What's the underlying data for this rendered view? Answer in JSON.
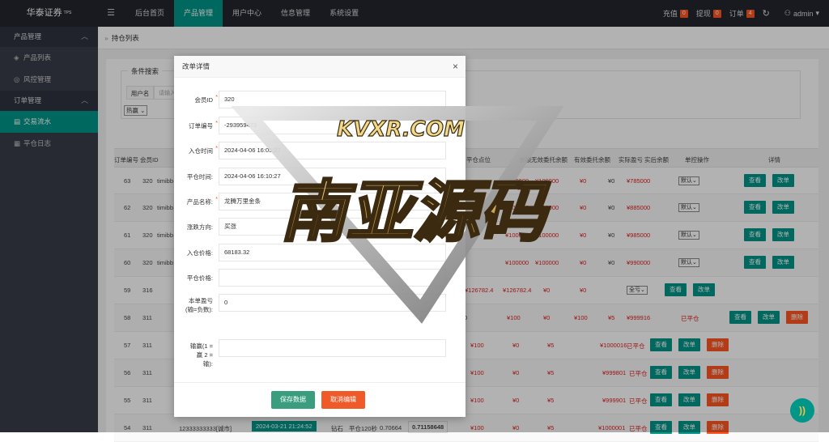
{
  "brand": {
    "name": "华泰证券",
    "sup": "TPS"
  },
  "topnav": {
    "toggle_icon": "☰",
    "items": [
      "后台首页",
      "产品管理",
      "用户中心",
      "信息管理",
      "系统设置"
    ],
    "active_index": 1
  },
  "topright": {
    "recharge": "充值",
    "recharge_count": "0",
    "withdraw": "提现",
    "withdraw_count": "0",
    "orders": "订单",
    "orders_count": "4",
    "refresh_icon": "↻",
    "user": "admin",
    "user_icon": "person-icon"
  },
  "sidebar": {
    "group1": "产品管理",
    "item1": "产品列表",
    "item2": "风控管理",
    "group2": "订单管理",
    "item3": "交易流水",
    "item4": "平仓日志"
  },
  "breadcrumb": "持仓列表",
  "filter": {
    "legend": "条件搜索",
    "user_label": "用户名",
    "user_placeholder": "请输入",
    "select_value": "热赢"
  },
  "table": {
    "headers": {
      "order": "订单编号",
      "member": "会员ID",
      "close_pt": "平仓点位",
      "bal": "余额",
      "unfrozen": "无效委托余额",
      "valid": "有效委托余额",
      "actual": "实际盈亏",
      "after": "实后余额",
      "ctrl": "单控操作",
      "detail": "详情"
    },
    "rows": [
      {
        "id": "63",
        "mid": "320",
        "user": "timibb",
        "amt": "¥100000",
        "unf": "¥100000",
        "valid": "¥0",
        "act": "¥0",
        "after": "¥785000",
        "ctrl": "默认",
        "view": "查看",
        "edit": "改单"
      },
      {
        "id": "62",
        "mid": "320",
        "user": "timibb",
        "amt": "¥100000",
        "unf": "¥100000",
        "valid": "¥0",
        "act": "¥0",
        "after": "¥885000",
        "ctrl": "默认",
        "view": "查看",
        "edit": "改单"
      },
      {
        "id": "61",
        "mid": "320",
        "user": "timibb",
        "amt": "¥100000",
        "unf": "¥100000",
        "valid": "¥0",
        "act": "¥0",
        "after": "¥985000",
        "ctrl": "默认",
        "view": "查看",
        "edit": "改单"
      },
      {
        "id": "60",
        "mid": "320",
        "user": "timibb",
        "amt": "¥100000",
        "unf": "¥100000",
        "valid": "¥0",
        "act": "¥0",
        "after": "¥990000",
        "ctrl": "默认",
        "view": "查看",
        "edit": "改单"
      },
      {
        "id": "59",
        "mid": "316",
        "amt": "¥126782.4",
        "unf": "¥126782.4",
        "valid": "¥0",
        "act": "¥0",
        "ctrl": "全亏",
        "view": "查看",
        "edit": "改单"
      },
      {
        "id": "58",
        "mid": "311",
        "pt": "0",
        "amt": "¥100",
        "unf": "¥0",
        "valid": "¥100",
        "act": "¥5",
        "after": "¥999916",
        "status": "已平仓",
        "view": "查看",
        "edit": "改单",
        "del": "删除"
      },
      {
        "id": "57",
        "mid": "311",
        "amt": "¥100",
        "unf": "¥0",
        "valid": "¥5",
        "after": "¥1000016",
        "status": "已平仓",
        "view": "查看",
        "edit": "改单",
        "del": "删除"
      },
      {
        "id": "56",
        "mid": "311",
        "amt": "¥100",
        "unf": "¥0",
        "valid": "¥5",
        "after": "¥999801",
        "status": "已平仓",
        "view": "查看",
        "edit": "改单",
        "del": "删除"
      },
      {
        "id": "55",
        "mid": "311",
        "amt": "¥100",
        "unf": "¥0",
        "valid": "¥5",
        "after": "¥999901",
        "status": "已平仓",
        "view": "查看",
        "edit": "改单",
        "del": "删除"
      },
      {
        "id": "54",
        "mid": "311",
        "user": "12333333333[诚市]",
        "time": "2024-03-21 21:24:52",
        "prod": "钻石",
        "close": "平仓120秒",
        "p1": "0.70664",
        "p2": "0.71158648",
        "amt": "¥100",
        "unf": "¥0",
        "valid": "¥5",
        "after": "¥1000001",
        "status": "已平仓",
        "view": "查看",
        "edit": "改单",
        "del": "删除"
      }
    ]
  },
  "modal": {
    "title": "改单详情",
    "close_icon": "×",
    "fields": [
      {
        "label": "会员ID",
        "value": "320"
      },
      {
        "label": "订单编号",
        "value": "-293959473"
      },
      {
        "label": "入仓时间",
        "value": "2024-04-06 16:05:27"
      },
      {
        "label": "平仓时间:",
        "value": "2024-04-06 16:10:27"
      },
      {
        "label": "产品名称:",
        "value": "龙腾万里金条"
      },
      {
        "label": "涨跌方向:",
        "value": "买涨"
      },
      {
        "label": "入仓价格:",
        "value": "68183.32"
      },
      {
        "label": "平仓价格:",
        "value": ""
      },
      {
        "label": "本单盈亏(输=负数):",
        "value": "0"
      },
      {
        "label": "输赢(1 = 赢 2 = 输):",
        "value": ""
      }
    ],
    "save": "保存数据",
    "cancel": "取消编辑"
  },
  "watermark": {
    "top": "KVXR.COM",
    "main": "南亚源码"
  },
  "fab_icon": "))",
  "colors": {
    "accent": "#009688",
    "danger": "#ff5722",
    "dark": "#23262e",
    "sidebar": "#393d49"
  }
}
